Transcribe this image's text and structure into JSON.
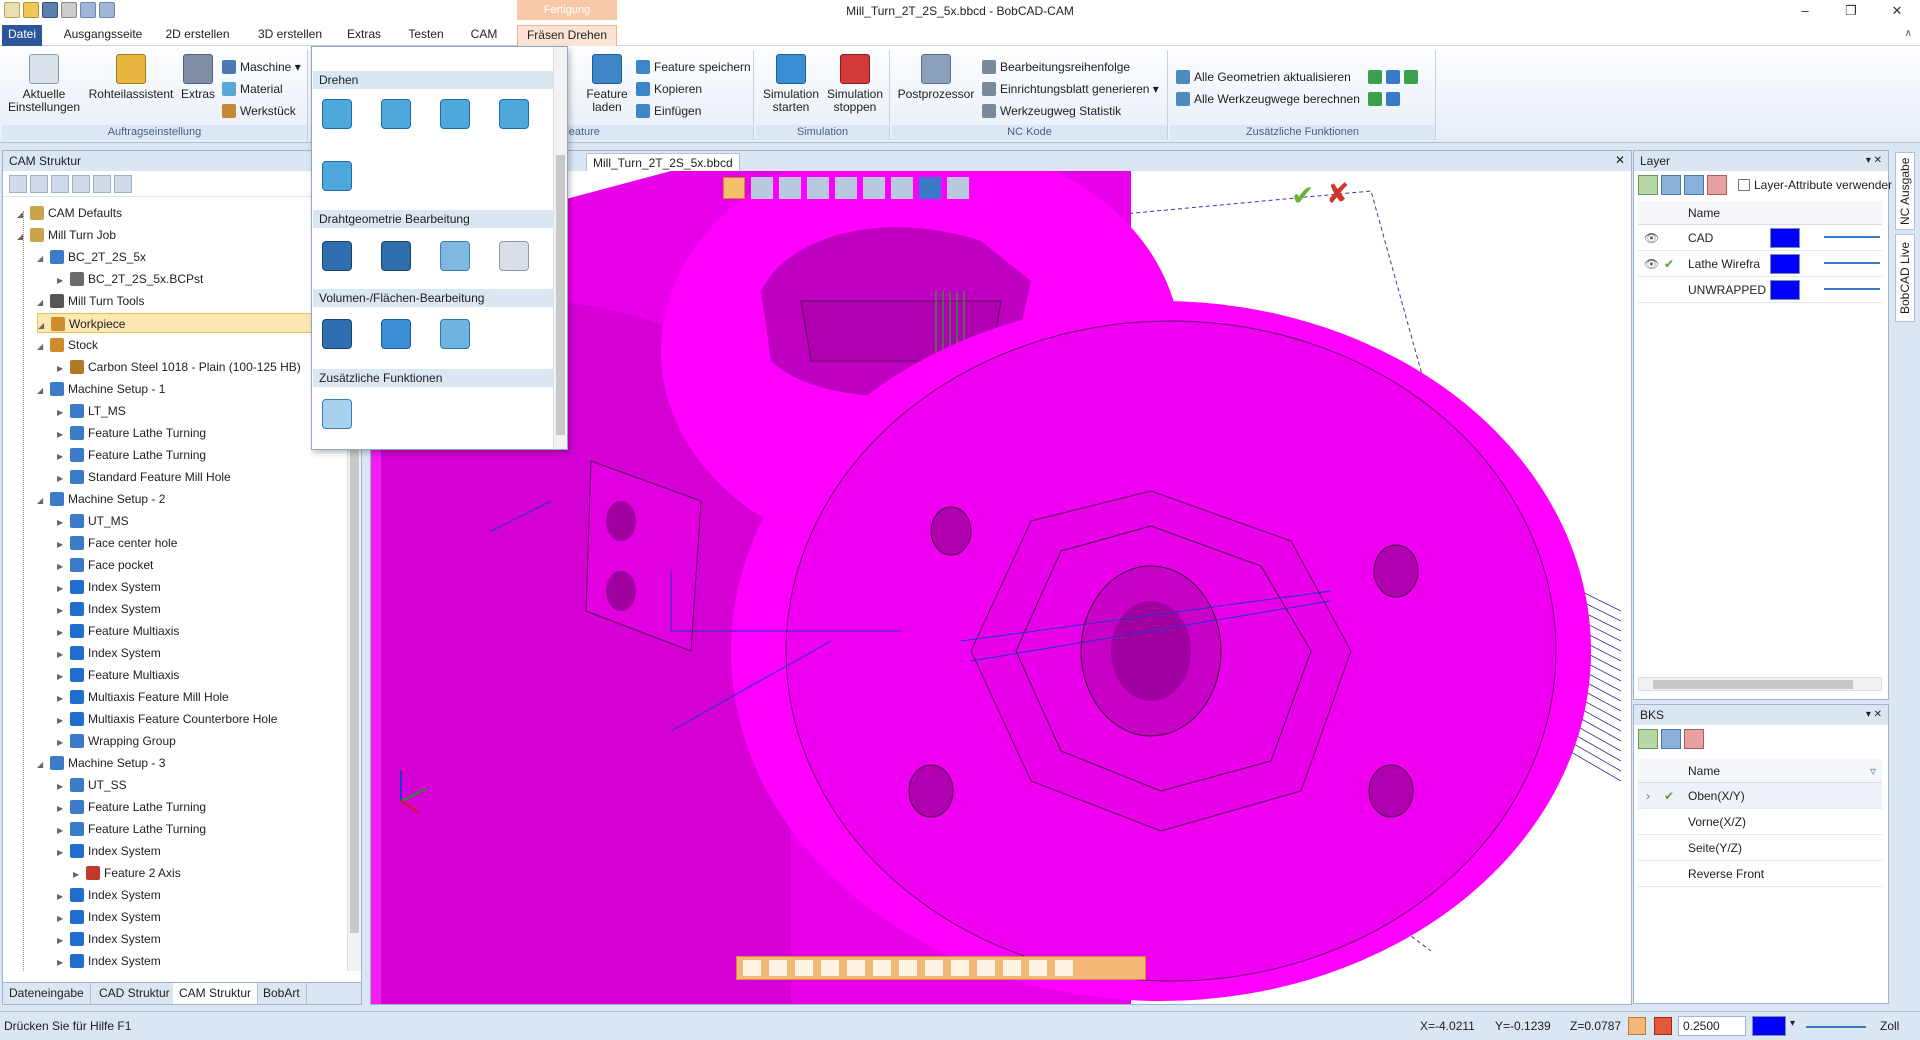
{
  "window": {
    "title": "Mill_Turn_2T_2S_5x.bbcd - BobCAD-CAM",
    "contextual_group": "Fertigung"
  },
  "tabs": [
    "Datei",
    "Ausgangsseite",
    "2D erstellen",
    "3D erstellen",
    "Extras",
    "Testen",
    "CAM",
    "Fräsen Drehen"
  ],
  "ribbon": {
    "auftrag": {
      "label": "Auftragseinstellung",
      "aktuelle": "Aktuelle Einstellungen",
      "rohteil": "Rohteilassistent",
      "extras": "Extras",
      "maschine": "Maschine",
      "material": "Material",
      "werkstueck": "Werkstück"
    },
    "feature": {
      "label": "Feature",
      "laden": "Feature laden",
      "speichern": "Feature speichern",
      "kopieren": "Kopieren",
      "einfuegen": "Einfügen"
    },
    "simulation": {
      "label": "Simulation",
      "starten": "Simulation starten",
      "stoppen": "Simulation stoppen"
    },
    "nc": {
      "label": "NC Kode",
      "post": "Postprozessor",
      "reihenfolge": "Bearbeitungsreihenfolge",
      "einrichtung": "Einrichtungsblatt generieren",
      "statistik": "Werkzeugweg Statistik"
    },
    "zusatz": {
      "label": "Zusätzliche Funktionen",
      "geom": "Alle Geometrien aktualisieren",
      "wege": "Alle Werkzeugwege berechnen"
    }
  },
  "dropdown": {
    "sections": [
      "Drehen",
      "Drahtgeometrie Bearbeitung",
      "Volumen-/Flächen-Bearbeitung",
      "Zusätzliche Funktionen"
    ]
  },
  "cam_panel": {
    "title": "CAM Struktur",
    "tree": [
      {
        "label": "CAM Defaults",
        "lvl": 1,
        "icon": "folder-icon",
        "color": "#c9a24a"
      },
      {
        "label": "Mill Turn Job",
        "lvl": 1,
        "icon": "folder-icon",
        "color": "#c9a24a"
      },
      {
        "label": "BC_2T_2S_5x",
        "lvl": 2,
        "icon": "part-icon",
        "color": "#3b7bc8"
      },
      {
        "label": "BC_2T_2S_5x.BCPst",
        "lvl": 3,
        "icon": "post-icon",
        "color": "#6a6a6a"
      },
      {
        "label": "Mill Turn Tools",
        "lvl": 2,
        "icon": "tool-icon",
        "color": "#555555"
      },
      {
        "label": "Workpiece",
        "lvl": 2,
        "icon": "workpiece-icon",
        "color": "#d08b2a",
        "selected": true
      },
      {
        "label": "Stock",
        "lvl": 2,
        "icon": "stock-icon",
        "color": "#d08b2a"
      },
      {
        "label": "Carbon Steel 1018 - Plain (100-125 HB)",
        "lvl": 3,
        "icon": "material-icon",
        "color": "#b07a2a"
      },
      {
        "label": "Machine Setup - 1",
        "lvl": 2,
        "icon": "axis-icon",
        "color": "#3b7bc8"
      },
      {
        "label": "LT_MS",
        "lvl": 3,
        "icon": "setup-icon",
        "color": "#3b7bc8"
      },
      {
        "label": "Feature Lathe Turning",
        "lvl": 3,
        "icon": "feature-icon",
        "color": "#3b7bc8"
      },
      {
        "label": "Feature Lathe Turning",
        "lvl": 3,
        "icon": "feature-icon",
        "color": "#3b7bc8"
      },
      {
        "label": "Standard Feature Mill Hole",
        "lvl": 3,
        "icon": "feature-icon",
        "color": "#3b7bc8"
      },
      {
        "label": "Machine Setup - 2",
        "lvl": 2,
        "icon": "axis-icon",
        "color": "#3b7bc8"
      },
      {
        "label": "UT_MS",
        "lvl": 3,
        "icon": "setup-icon",
        "color": "#3b7bc8"
      },
      {
        "label": "Face center hole",
        "lvl": 3,
        "icon": "feature-icon",
        "color": "#3b7bc8"
      },
      {
        "label": "Face pocket",
        "lvl": 3,
        "icon": "feature-icon",
        "color": "#3b7bc8"
      },
      {
        "label": "Index System",
        "lvl": 3,
        "icon": "index-icon",
        "color": "#1f6fd1"
      },
      {
        "label": "Index System",
        "lvl": 3,
        "icon": "index-icon",
        "color": "#1f6fd1"
      },
      {
        "label": "Feature Multiaxis",
        "lvl": 3,
        "icon": "index-icon",
        "color": "#1f6fd1"
      },
      {
        "label": "Index System",
        "lvl": 3,
        "icon": "index-icon",
        "color": "#1f6fd1"
      },
      {
        "label": "Feature Multiaxis",
        "lvl": 3,
        "icon": "index-icon",
        "color": "#1f6fd1"
      },
      {
        "label": "Multiaxis Feature Mill Hole",
        "lvl": 3,
        "icon": "index-icon",
        "color": "#1f6fd1"
      },
      {
        "label": "Multiaxis Feature Counterbore Hole",
        "lvl": 3,
        "icon": "index-icon",
        "color": "#1f6fd1"
      },
      {
        "label": "Wrapping Group",
        "lvl": 3,
        "icon": "wrap-icon",
        "color": "#3b7bc8"
      },
      {
        "label": "Machine Setup - 3",
        "lvl": 2,
        "icon": "axis-icon",
        "color": "#3b7bc8"
      },
      {
        "label": "UT_SS",
        "lvl": 3,
        "icon": "setup-icon",
        "color": "#3b7bc8"
      },
      {
        "label": "Feature Lathe Turning",
        "lvl": 3,
        "icon": "feature-icon",
        "color": "#3b7bc8"
      },
      {
        "label": "Feature Lathe Turning",
        "lvl": 3,
        "icon": "feature-icon",
        "color": "#3b7bc8"
      },
      {
        "label": "Index System",
        "lvl": 3,
        "icon": "index-icon",
        "color": "#1f6fd1"
      },
      {
        "label": "Feature 2 Axis",
        "lvl": 4,
        "icon": "feature2axis-icon",
        "color": "#c0392b"
      },
      {
        "label": "Index System",
        "lvl": 3,
        "icon": "index-icon",
        "color": "#1f6fd1"
      },
      {
        "label": "Index System",
        "lvl": 3,
        "icon": "index-icon",
        "color": "#1f6fd1"
      },
      {
        "label": "Index System",
        "lvl": 3,
        "icon": "index-icon",
        "color": "#1f6fd1"
      },
      {
        "label": "Index System",
        "lvl": 3,
        "icon": "index-icon",
        "color": "#1f6fd1"
      }
    ],
    "bottom_tabs": [
      "Dateneingabe",
      "CAD Struktur",
      "CAM Struktur",
      "BobArt"
    ]
  },
  "document": {
    "tab_label": "Mill_Turn_2T_2S_5x.bbcd"
  },
  "layer_panel": {
    "title": "Layer",
    "checkbox_label": "Layer-Attribute verwenden",
    "col_name": "Name",
    "rows": [
      "CAD",
      "Lathe Wirefra",
      "UNWRAPPED"
    ]
  },
  "bks_panel": {
    "title": "BKS",
    "col_name": "Name",
    "rows": [
      "Oben(X/Y)",
      "Vorne(X/Z)",
      "Seite(Y/Z)",
      "Reverse Front"
    ]
  },
  "side_tabs": [
    "NC Ausgabe",
    "BobCAD Live"
  ],
  "status": {
    "help": "Drücken Sie für Hilfe F1",
    "x": "X=-4.0211",
    "y": "Y=-0.1239",
    "z": "Z=0.0787",
    "tolerance": "0.2500",
    "unit": "Zoll"
  },
  "colors": {
    "part": "#ff00ff",
    "accent": "#2b579a",
    "swatch": "#0000ff"
  }
}
